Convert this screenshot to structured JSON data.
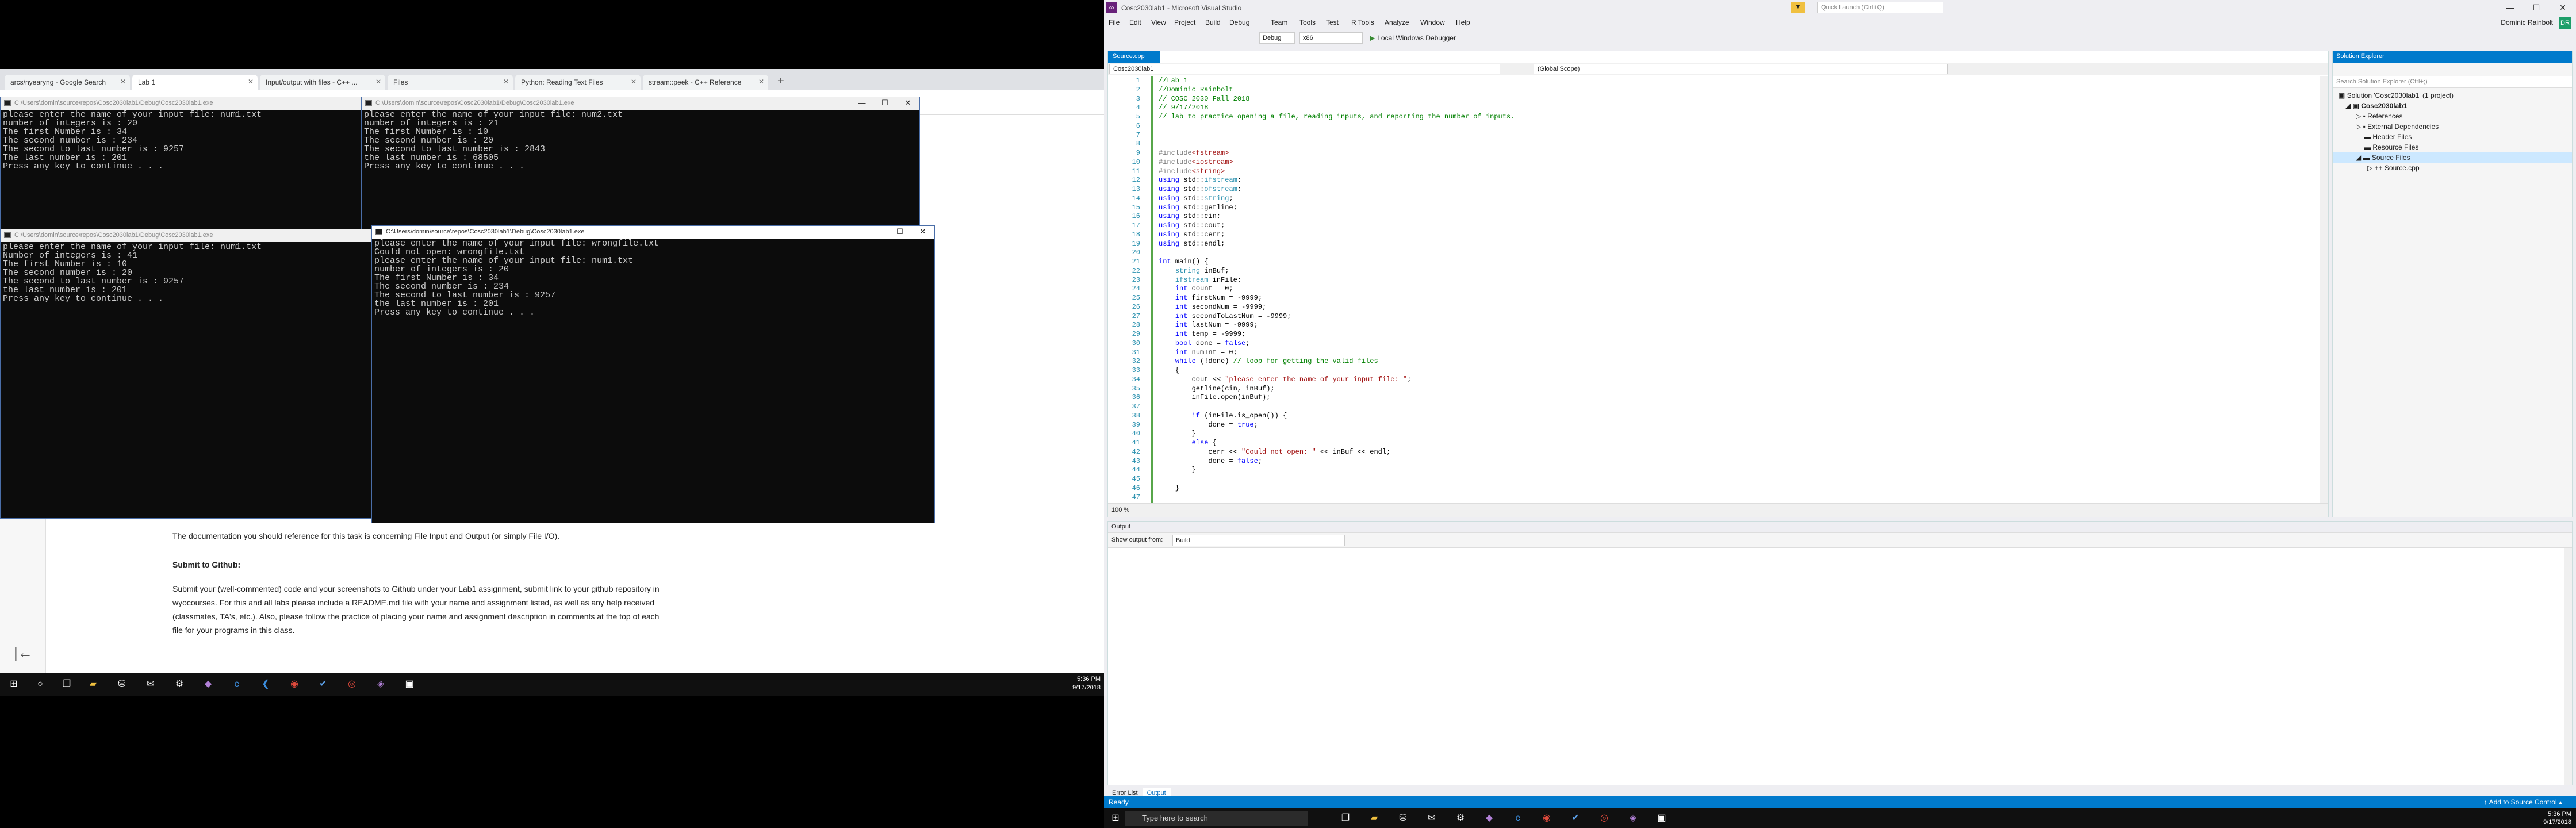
{
  "left_monitor": {
    "browser": {
      "tabs": [
        "arcs/nyearyng - Google Search",
        "Lab 1",
        "Input/output with files - C++ ...",
        "Files",
        "Python: Reading Text Files",
        "stream::peek - C++ Reference"
      ],
      "new_tab": "+",
      "doc_intro": "The documentation you should reference for this task is concerning File Input and Output (or simply File I/O).",
      "doc_heading": "Submit to Github:",
      "doc_body": "Submit your (well-commented) code and your screenshots to Github under your Lab1 assignment, submit link to your github repository in wyocourses. For this and all labs please include a README.md file with your name and assignment listed, as well as any help received (classmates, TA's, etc.). Also, please follow the practice of placing your name and assignment description in comments at the top of each file for your programs in this class.",
      "back_glyph": "|←"
    },
    "consoles": [
      {
        "title": "C:\\Users\\domin\\source\\repos\\Cosc2030lab1\\Debug\\Cosc2030lab1.exe",
        "lines": [
          "please enter the name of your input file: num1.txt",
          "number of integers is : 20",
          "The first Number is : 34",
          "The second number is : 234",
          "The second to last number is : 9257",
          "The last number is : 201",
          "Press any key to continue . . ."
        ]
      },
      {
        "title": "C:\\Users\\domin\\source\\repos\\Cosc2030lab1\\Debug\\Cosc2030lab1.exe",
        "lines": [
          "please enter the name of your input file: num2.txt",
          "number of integers is : 21",
          "The first Number is : 10",
          "The second number is : 20",
          "The second to last number is : 2843",
          "the last number is : 68505",
          "Press any key to continue . . ."
        ]
      },
      {
        "title": "C:\\Users\\domin\\source\\repos\\Cosc2030lab1\\Debug\\Cosc2030lab1.exe",
        "lines": [
          "please enter the name of your input file: num1.txt",
          "Number of integers is : 41",
          "The first Number is : 10",
          "The second number is : 20",
          "The second to last number is : 9257",
          "the last number is : 201",
          "Press any key to continue . . ."
        ]
      },
      {
        "title": "C:\\Users\\domin\\source\\repos\\Cosc2030lab1\\Debug\\Cosc2030lab1.exe",
        "lines": [
          "please enter the name of your input file: wrongfile.txt",
          "Could not open: wrongfile.txt",
          "please enter the name of your input file: num1.txt",
          "number of integers is : 20",
          "The first Number is : 34",
          "The second number is : 234",
          "The second to last number is : 9257",
          "the last number is : 201",
          "Press any key to continue . . ."
        ]
      }
    ],
    "taskbar": {
      "time": "5:36 PM",
      "date": "9/17/2018"
    }
  },
  "vs": {
    "title": "Cosc2030lab1 - Microsoft Visual Studio",
    "quick_launch": "Quick Launch (Ctrl+Q)",
    "user": "Dominic Rainbolt",
    "avatar": "DR",
    "menus": [
      "File",
      "Edit",
      "View",
      "Project",
      "Build",
      "Debug",
      "Team",
      "Tools",
      "Test",
      "R Tools",
      "Analyze",
      "Window",
      "Help"
    ],
    "config": "Debug",
    "platform": "x86",
    "run": "Local Windows Debugger",
    "editor_tab": "Source.cpp",
    "nav_project": "Cosc2030lab1",
    "nav_scope": "(Global Scope)",
    "zoom": "100 %",
    "code_line_count": 47,
    "solution_explorer": {
      "title": "Solution Explorer",
      "search": "Search Solution Explorer (Ctrl+;)",
      "items": [
        "Solution 'Cosc2030lab1' (1 project)",
        "Cosc2030lab1",
        "References",
        "External Dependencies",
        "Header Files",
        "Resource Files",
        "Source Files",
        "Source.cpp"
      ]
    },
    "output": {
      "title": "Output",
      "show_from_label": "Show output from:",
      "show_from": "Build"
    },
    "bottom_tabs": [
      "Error List",
      "Output"
    ],
    "status": "Ready",
    "add_source_control": "↑ Add to Source Control ▴",
    "taskbar": {
      "search": "Type here to search",
      "time": "5:36 PM",
      "date": "9/17/2018"
    }
  }
}
